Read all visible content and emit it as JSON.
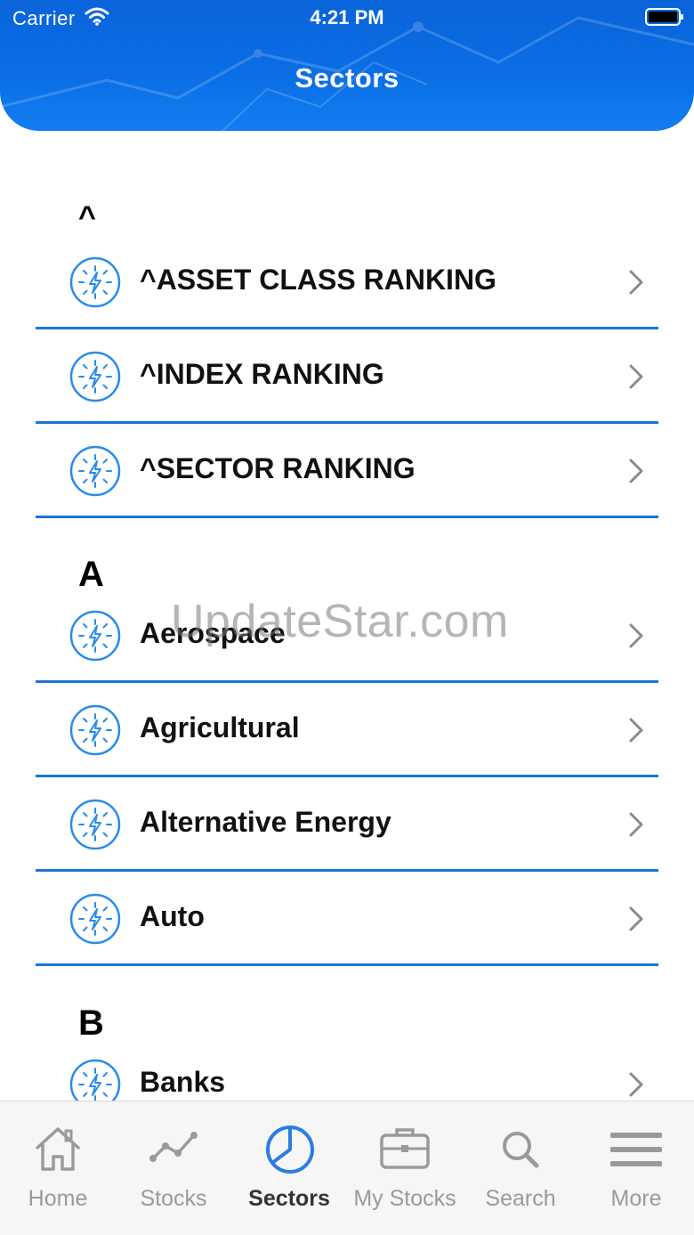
{
  "status_bar": {
    "carrier": "Carrier",
    "time": "4:21 PM"
  },
  "header": {
    "title": "Sectors"
  },
  "colors": {
    "header_blue": "#0b6fe6",
    "divider_blue": "#1976d8",
    "icon_blue": "#2a8bea",
    "active_tab_blue": "#2a7de1"
  },
  "sections": [
    {
      "letter": "^",
      "items": [
        {
          "label": "^ASSET CLASS RANKING",
          "icon": "lightning-circle-icon"
        },
        {
          "label": "^INDEX RANKING",
          "icon": "lightning-circle-icon"
        },
        {
          "label": "^SECTOR RANKING",
          "icon": "lightning-circle-icon"
        }
      ]
    },
    {
      "letter": "A",
      "items": [
        {
          "label": "Aerospace",
          "icon": "lightning-circle-icon"
        },
        {
          "label": "Agricultural",
          "icon": "lightning-circle-icon"
        },
        {
          "label": "Alternative Energy",
          "icon": "lightning-circle-icon"
        },
        {
          "label": "Auto",
          "icon": "lightning-circle-icon"
        }
      ]
    },
    {
      "letter": "B",
      "items": [
        {
          "label": "Banks",
          "icon": "lightning-circle-icon"
        }
      ]
    }
  ],
  "watermark": "UpdateStar.com",
  "tab_bar": {
    "tabs": [
      {
        "label": "Home",
        "icon": "house-icon",
        "active": false
      },
      {
        "label": "Stocks",
        "icon": "line-chart-icon",
        "active": false
      },
      {
        "label": "Sectors",
        "icon": "pie-chart-icon",
        "active": true
      },
      {
        "label": "My Stocks",
        "icon": "briefcase-icon",
        "active": false
      },
      {
        "label": "Search",
        "icon": "magnifier-icon",
        "active": false
      },
      {
        "label": "More",
        "icon": "hamburger-icon",
        "active": false
      }
    ]
  }
}
